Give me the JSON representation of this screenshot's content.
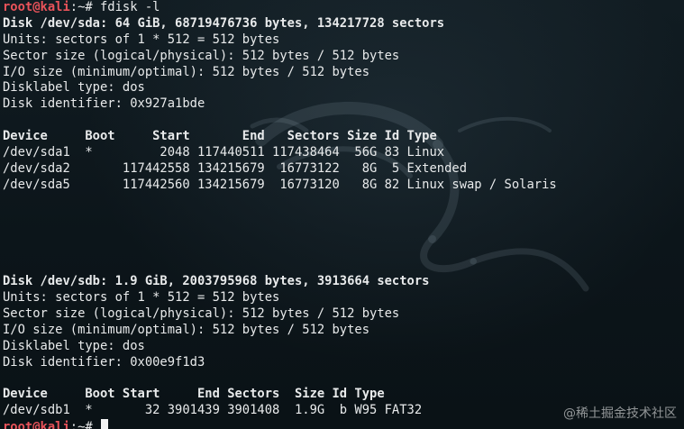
{
  "colors": {
    "background": "#0c1418",
    "text": "#e8eaeb",
    "prompt_user": "#e9535a"
  },
  "prompt": {
    "user_host": "root@kali",
    "path_symbol": ":~#"
  },
  "commands": {
    "first": " fdisk -l",
    "last": " "
  },
  "disk_sda": {
    "header": "Disk /dev/sda: 64 GiB, 68719476736 bytes, 134217728 sectors",
    "units": "Units: sectors of 1 * 512 = 512 bytes",
    "sector_size": "Sector size (logical/physical): 512 bytes / 512 bytes",
    "io_size": "I/O size (minimum/optimal): 512 bytes / 512 bytes",
    "label_type": "Disklabel type: dos",
    "identifier": "Disk identifier: 0x927a1bde",
    "table_header": "Device     Boot     Start       End   Sectors Size Id Type",
    "rows": [
      "/dev/sda1  *         2048 117440511 117438464  56G 83 Linux",
      "/dev/sda2       117442558 134215679  16773122   8G  5 Extended",
      "/dev/sda5       117442560 134215679  16773120   8G 82 Linux swap / Solaris"
    ]
  },
  "disk_sdb": {
    "header": "Disk /dev/sdb: 1.9 GiB, 2003795968 bytes, 3913664 sectors",
    "units": "Units: sectors of 1 * 512 = 512 bytes",
    "sector_size": "Sector size (logical/physical): 512 bytes / 512 bytes",
    "io_size": "I/O size (minimum/optimal): 512 bytes / 512 bytes",
    "label_type": "Disklabel type: dos",
    "identifier": "Disk identifier: 0x00e9f1d3",
    "table_header": "Device     Boot Start     End Sectors  Size Id Type",
    "rows": [
      "/dev/sdb1  *       32 3901439 3901408  1.9G  b W95 FAT32"
    ]
  },
  "watermark": {
    "text": "@稀土掘金技术社区",
    "logo_icon": "kali-dragon-icon"
  }
}
